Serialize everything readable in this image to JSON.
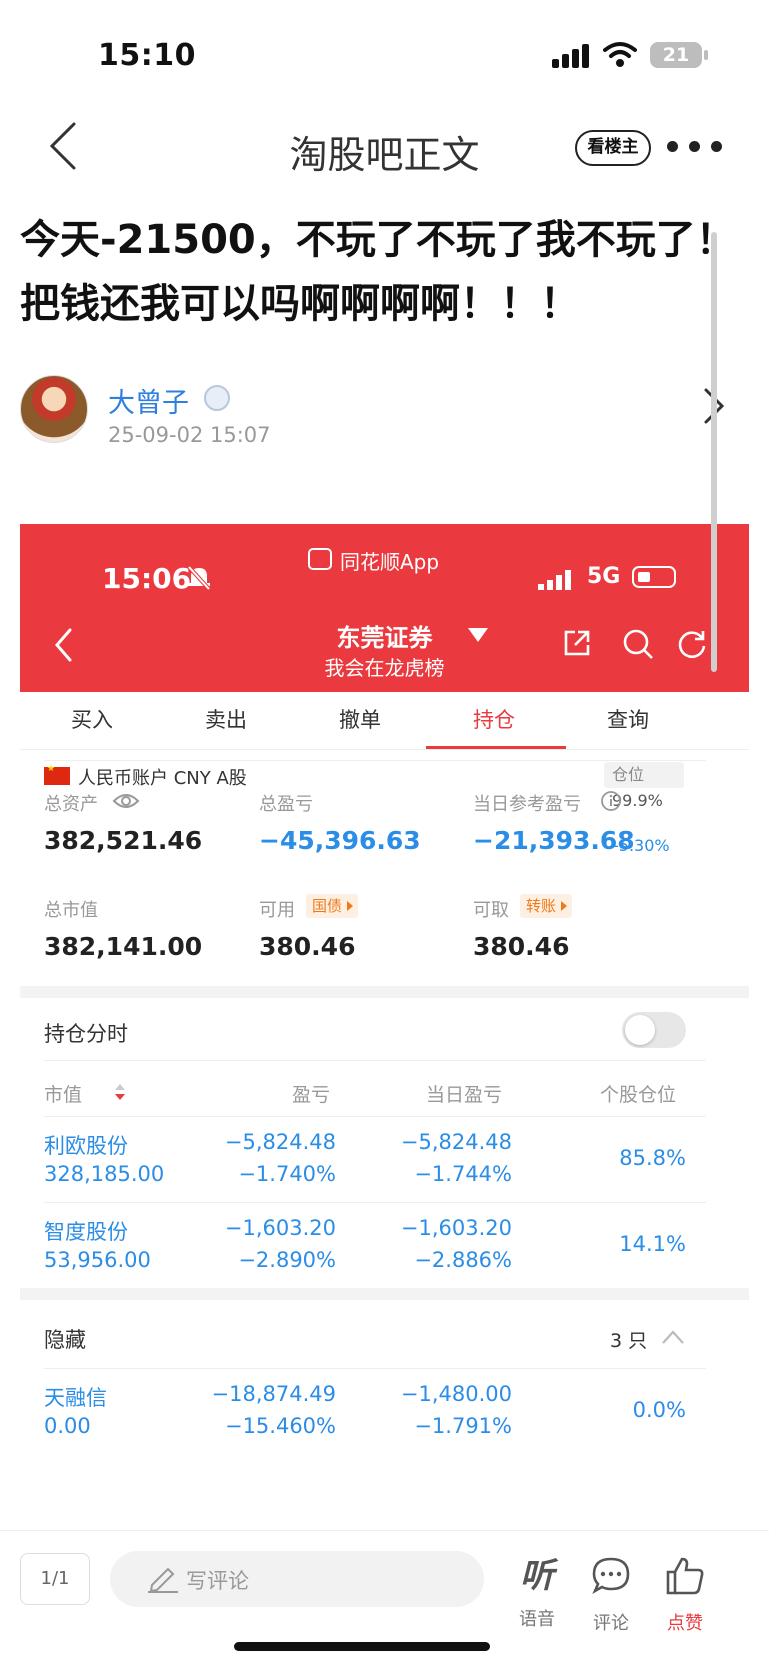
{
  "status_bar": {
    "time": "15:10",
    "battery": "21"
  },
  "nav": {
    "title": "淘股吧正文",
    "op_only_label": "看楼主"
  },
  "post": {
    "title": "今天-21500，不玩了不玩了我不玩了！把钱还我可以吗啊啊啊啊！！！",
    "author": "大曾子",
    "time": "25-09-02 15:07"
  },
  "screenshot": {
    "status": {
      "time": "15:06",
      "app": "同花顺App",
      "network": "5G"
    },
    "header": {
      "broker": "东莞证券",
      "subtitle": "我会在龙虎榜"
    },
    "tabs": [
      "买入",
      "卖出",
      "撤单",
      "持仓",
      "查询"
    ],
    "active_tab": "持仓",
    "account": {
      "label": "人民币账户 CNY A股",
      "position_label": "仓位",
      "position_value": "99.9%"
    },
    "metrics": {
      "total_assets_label": "总资产",
      "total_assets": "382,521.46",
      "total_pnl_label": "总盈亏",
      "total_pnl": "−45,396.63",
      "daily_pnl_label": "当日参考盈亏",
      "daily_pnl": "−21,393.68",
      "daily_pnl_pct": "-5.30%",
      "market_value_label": "总市值",
      "market_value": "382,141.00",
      "available_label": "可用",
      "available_tag": "国债",
      "available": "380.46",
      "withdrawable_label": "可取",
      "withdrawable_tag": "转账",
      "withdrawable": "380.46"
    },
    "intraday": {
      "label": "持仓分时",
      "enabled": false
    },
    "columns": [
      "市值",
      "盈亏",
      "当日盈亏",
      "个股仓位"
    ],
    "holdings": [
      {
        "name": "利欧股份",
        "market_value": "328,185.00",
        "pnl": "−5,824.48",
        "pnl_pct": "−1.740%",
        "daily_pnl": "−5,824.48",
        "daily_pct": "−1.744%",
        "weight": "85.8%"
      },
      {
        "name": "智度股份",
        "market_value": "53,956.00",
        "pnl": "−1,603.20",
        "pnl_pct": "−2.890%",
        "daily_pnl": "−1,603.20",
        "daily_pct": "−2.886%",
        "weight": "14.1%"
      }
    ],
    "hidden": {
      "label": "隐藏",
      "count": "3 只",
      "items": [
        {
          "name": "天融信",
          "market_value": "0.00",
          "pnl": "−18,874.49",
          "pnl_pct": "−15.460%",
          "daily_pnl": "−1,480.00",
          "daily_pct": "−1.791%",
          "weight": "0.0%"
        }
      ]
    }
  },
  "bottom_bar": {
    "page": "1/1",
    "comment_placeholder": "写评论",
    "listen_glyph": "听",
    "listen_label": "语音",
    "comment_label": "评论",
    "like_label": "点赞"
  },
  "colors": {
    "accent_red": "#e83a3f",
    "link_blue": "#2d7fe0",
    "loss_blue": "#2b8de6",
    "tag_orange": "#f07a1a"
  }
}
